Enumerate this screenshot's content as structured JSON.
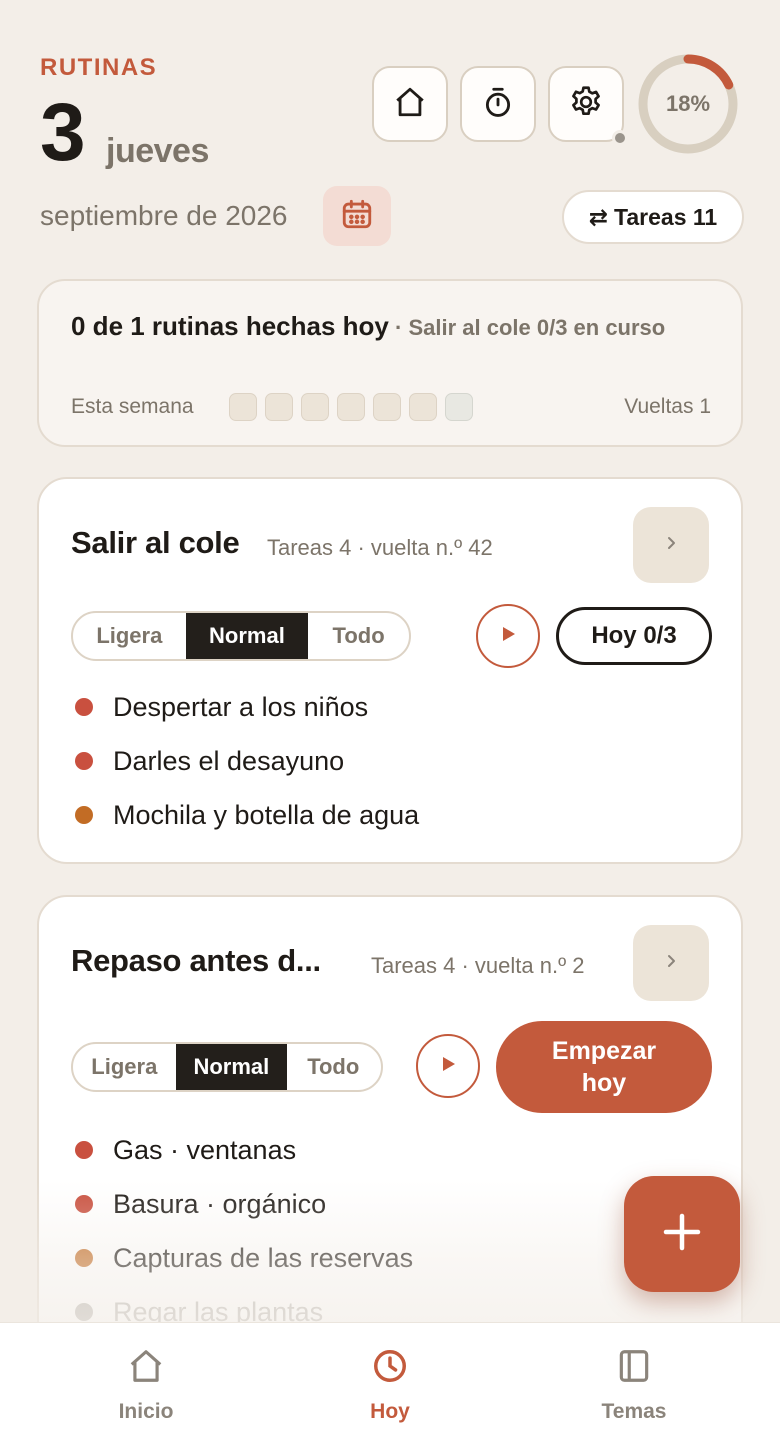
{
  "header": {
    "app_label": "RUTINAS",
    "day_number": "3",
    "weekday": "jueves",
    "month_year": "septiembre de 2026",
    "progress_percent": 18,
    "progress_label": "18%",
    "tasks_toggle_icon": "⇄",
    "tasks_toggle_label": "Tareas 11",
    "icons": [
      "home-icon",
      "timer-icon",
      "gear-icon",
      "calendar-icon"
    ]
  },
  "summary": {
    "main": "0 de 1 rutinas hechas hoy",
    "sub": " · Salir al cole 0/3 en curso",
    "week_label": "Esta semana",
    "week_days": 7,
    "laps": "Vueltas 1"
  },
  "routines": [
    {
      "title": "Salir al cole",
      "meta": "Tareas 4 · vuelta n.º 42",
      "modes": [
        "Ligera",
        "Normal",
        "Todo"
      ],
      "active_mode": "Normal",
      "action_label": "Hoy 0/3",
      "tasks": [
        {
          "text": "Despertar a los niños",
          "color": "#c9503f"
        },
        {
          "text": "Darles el desayuno",
          "color": "#c9503f"
        },
        {
          "text": "Mochila y botella de agua",
          "color": "#c26c25"
        }
      ]
    },
    {
      "title": "Repaso antes d...",
      "meta": "Tareas 4 · vuelta n.º 2",
      "modes": [
        "Ligera",
        "Normal",
        "Todo"
      ],
      "active_mode": "Normal",
      "action_label": "Empezar hoy",
      "tasks": [
        {
          "text": "Gas · ventanas",
          "color": "#c9503f"
        },
        {
          "text": "Basura · orgánico",
          "color": "#c9503f"
        },
        {
          "text": "Capturas de las reservas",
          "color": "#c26c25"
        },
        {
          "text": "Regar las plantas",
          "color": "#b6b2ad"
        }
      ]
    }
  ],
  "fab": {
    "icon": "plus-icon"
  },
  "bottom_nav": [
    {
      "label": "Inicio",
      "icon": "home-icon",
      "active": false
    },
    {
      "label": "Hoy",
      "icon": "clock-icon",
      "active": true
    },
    {
      "label": "Temas",
      "icon": "book-icon",
      "active": false
    }
  ],
  "colors": {
    "accent": "#c35a3c",
    "background": "#f3eee8",
    "text": "#1f1b17",
    "muted": "#7c7469"
  }
}
